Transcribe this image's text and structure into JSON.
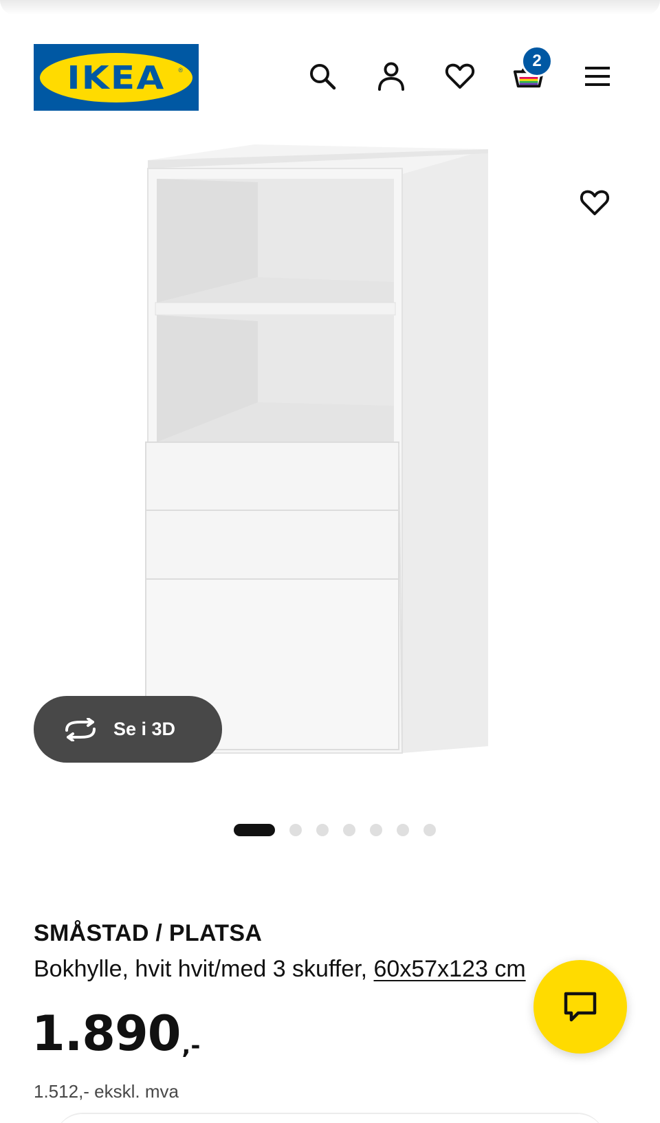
{
  "header": {
    "logo_text": "IKEA",
    "logo_reg": "®",
    "cart_count": "2",
    "icons": [
      "search-icon",
      "profile-icon",
      "heart-icon",
      "cart-icon",
      "menu-icon"
    ]
  },
  "gallery": {
    "view_3d_label": "Se i 3D",
    "slide_count": 7,
    "active_slide": 1
  },
  "product": {
    "name": "SMÅSTAD / PLATSA",
    "description": "Bokhylle, hvit hvit/med 3 skuffer,",
    "dimensions": "60x57x123 cm",
    "price": "1.890",
    "price_suffix": ",-",
    "price_ex_vat": "1.512,- ekskl. mva"
  },
  "colors": {
    "ikea_blue": "#0058a3",
    "ikea_yellow": "#ffdb00",
    "dark_button": "#484848"
  }
}
